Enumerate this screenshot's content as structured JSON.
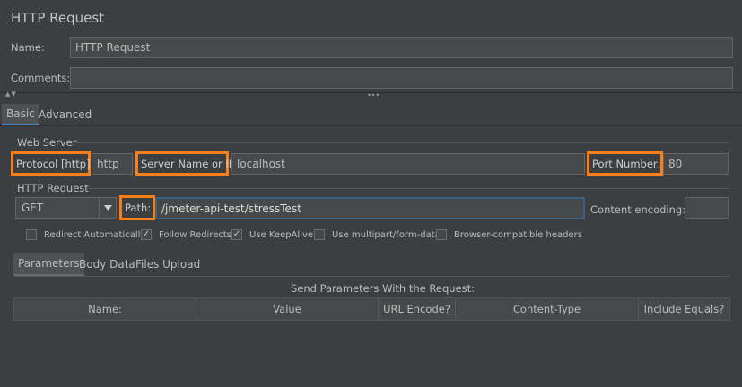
{
  "window": {
    "title": "HTTP Request"
  },
  "name_field": {
    "label": "Name:",
    "value": "HTTP Request"
  },
  "comments_field": {
    "label": "Comments:",
    "value": ""
  },
  "collapse_icons": {
    "left": "▲▼",
    "center": "•••"
  },
  "tabs": [
    {
      "label": "Basic"
    },
    {
      "label": "Advanced"
    }
  ],
  "web_server": {
    "section_label": "Web Server",
    "protocol_label": "Protocol [http]:",
    "protocol_value": "http",
    "server_label": "Server Name or IP:",
    "server_value": "localhost",
    "port_label": "Port Number:",
    "port_value": "80"
  },
  "http_request": {
    "section_label": "HTTP Request",
    "method": "GET",
    "path_label": "Path:",
    "path_value": "/jmeter-api-test/stressTest",
    "encoding_label": "Content encoding:",
    "encoding_value": ""
  },
  "options": [
    {
      "label": "Redirect Automatically",
      "checked": false
    },
    {
      "label": "Follow Redirects",
      "checked": true
    },
    {
      "label": "Use KeepAlive",
      "checked": true
    },
    {
      "label": "Use multipart/form-data",
      "checked": false
    },
    {
      "label": "Browser-compatible headers",
      "checked": false
    }
  ],
  "sub_tabs": [
    {
      "label": "Parameters"
    },
    {
      "label": "Body Data"
    },
    {
      "label": "Files Upload"
    }
  ],
  "params": {
    "caption": "Send Parameters With the Request:",
    "columns": [
      "Name:",
      "Value",
      "URL Encode?",
      "Content-Type",
      "Include Equals?"
    ]
  },
  "colors": {
    "highlight": "#f77f1a",
    "focus": "#3d6185",
    "background": "#3c3f41"
  }
}
